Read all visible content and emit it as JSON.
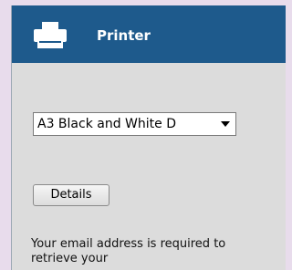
{
  "header": {
    "title": "Printer",
    "icon": "printer-icon"
  },
  "printer_select": {
    "selected": "A3 Black and White D"
  },
  "details_button": {
    "label": "Details"
  },
  "email_notice": {
    "text": "Your email address is required to retrieve your"
  },
  "colors": {
    "header": "#1e5a8c",
    "panel": "#dcdcdc",
    "page": "#e8dcec"
  }
}
